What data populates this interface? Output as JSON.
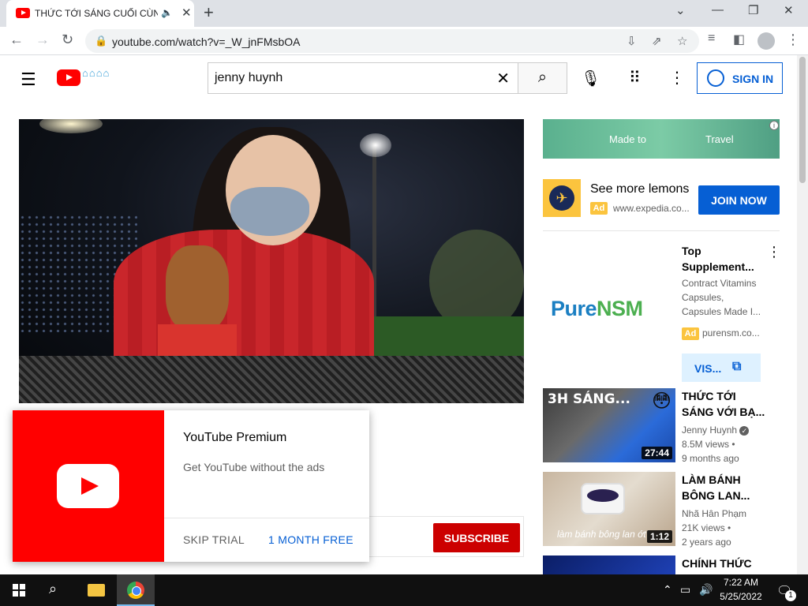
{
  "browser": {
    "tab_title": "THỨC TỚI SÁNG CUỐI CÙNG",
    "url": "youtube.com/watch?v=_W_jnFMsbOA"
  },
  "youtube": {
    "search_value": "jenny huynh",
    "sign_in_label": "SIGN IN"
  },
  "premium_popup": {
    "title": "YouTube Premium",
    "subtitle": "Get YouTube without the ads",
    "skip_label": "SKIP TRIAL",
    "free_label": "1 MONTH FREE"
  },
  "subscribe_label": "SUBSCRIBE",
  "sidebar": {
    "banner_ad": {
      "text_left": "Made to",
      "text_right": "Travel"
    },
    "expedia_ad": {
      "title": "See more lemons",
      "badge": "Ad",
      "url": "www.expedia.co...",
      "button_label": "JOIN NOW"
    },
    "pure_ad": {
      "logo_blue": "Pure",
      "logo_green": "NSM",
      "title_line1": "Top",
      "title_line2": "Supplement...",
      "desc_line1": "Contract Vitamins",
      "desc_line2": "Capsules,",
      "desc_line3": "Capsules Made I...",
      "badge": "Ad",
      "url": "purensm.co...",
      "button_label": "VIS..."
    },
    "videos": [
      {
        "title_line1": "THỨC TỚI",
        "title_line2": "SÁNG VỚI BẠ...",
        "channel": "Jenny Huynh",
        "views": "8.5M views •",
        "age": "9 months ago",
        "duration": "27:44",
        "thumb_text": "3H SÁNG..."
      },
      {
        "title_line1": "LÀM BÁNH",
        "title_line2": "BÔNG LAN...",
        "channel": "Nhã Hân Phạm",
        "views": "21K views •",
        "age": "2 years ago",
        "duration": "1:12",
        "thumb_text": "làm bánh bông lan ớt"
      },
      {
        "title_line1": "CHÍNH THỨC"
      }
    ]
  },
  "taskbar": {
    "time": "7:22 AM",
    "date": "5/25/2022",
    "notif_count": "1"
  },
  "colors": {
    "youtube_red": "#ff0000",
    "link_blue": "#065fd4",
    "subscribe_red": "#cc0000",
    "ad_yellow": "#fbc43e"
  }
}
